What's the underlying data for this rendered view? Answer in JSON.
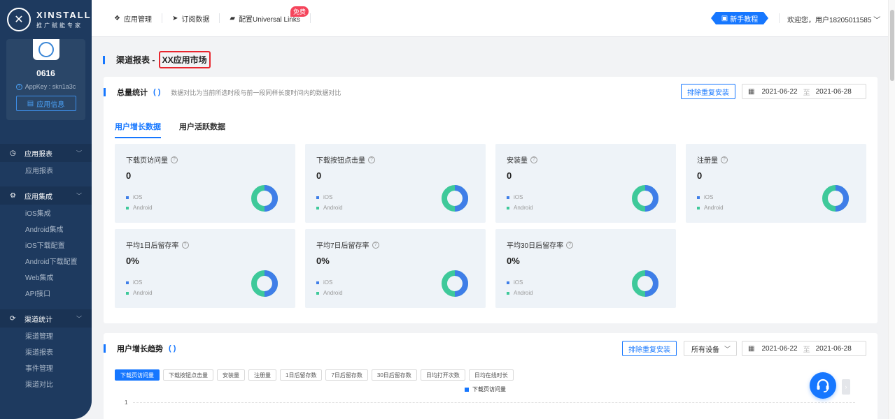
{
  "brand": {
    "title": "XINSTALL",
    "subtitle": "推广赋能专家"
  },
  "app": {
    "name": "0616",
    "appkey": "AppKey : skn1a3c",
    "info_button": "应用信息"
  },
  "sidebar": {
    "groups": [
      {
        "label": "应用报表",
        "icon": "clock-icon",
        "items": [
          "应用报表"
        ]
      },
      {
        "label": "应用集成",
        "icon": "gear-icon",
        "items": [
          "iOS集成",
          "Android集成",
          "iOS下载配置",
          "Android下载配置",
          "Web集成",
          "API接口"
        ]
      },
      {
        "label": "渠道统计",
        "icon": "share-icon",
        "items": [
          "渠道管理",
          "渠道报表",
          "事件管理",
          "渠道对比"
        ]
      }
    ]
  },
  "topbar": {
    "links": [
      "应用管理",
      "订阅数据",
      "配置Universal Links"
    ],
    "free_badge": "免费",
    "guide_button": "新手教程",
    "welcome": "欢迎您，用户18205011585"
  },
  "page": {
    "title_prefix": "渠道报表 - ",
    "title_highlight": "XX应用市场"
  },
  "summary": {
    "title": "总量统计",
    "description": "数据对比为当前所选时段与前一段同样长度时间内的数据对比",
    "exclude_button": "排除重复安装",
    "date_start": "2021-06-22",
    "date_sep": "至",
    "date_end": "2021-06-28",
    "tabs": [
      "用户增长数据",
      "用户活跃数据"
    ],
    "legend_ios": "iOS",
    "legend_android": "Android",
    "metrics": [
      {
        "label": "下载页访问量",
        "value": "0"
      },
      {
        "label": "下载按钮点击量",
        "value": "0"
      },
      {
        "label": "安装量",
        "value": "0"
      },
      {
        "label": "注册量",
        "value": "0"
      },
      {
        "label": "平均1日后留存率",
        "value": "0%"
      },
      {
        "label": "平均7日后留存率",
        "value": "0%"
      },
      {
        "label": "平均30日后留存率",
        "value": "0%"
      }
    ]
  },
  "trend": {
    "title": "用户增长趋势",
    "exclude_button": "排除重复安装",
    "device_select": "所有设备",
    "date_start": "2021-06-22",
    "date_sep": "至",
    "date_end": "2021-06-28",
    "chips": [
      "下载页访问量",
      "下载按钮点击量",
      "安装量",
      "注册量",
      "1日后留存数",
      "7日后留存数",
      "30日后留存数",
      "日均打开次数",
      "日均在线时长"
    ],
    "legend": "下载页访问量",
    "y_tick": "1"
  },
  "colors": {
    "primary": "#1677ff",
    "ios": "#3f7ee8",
    "android": "#3ec99a",
    "sidebar": "#1e3a5f",
    "highlight_border": "#e8262e"
  }
}
